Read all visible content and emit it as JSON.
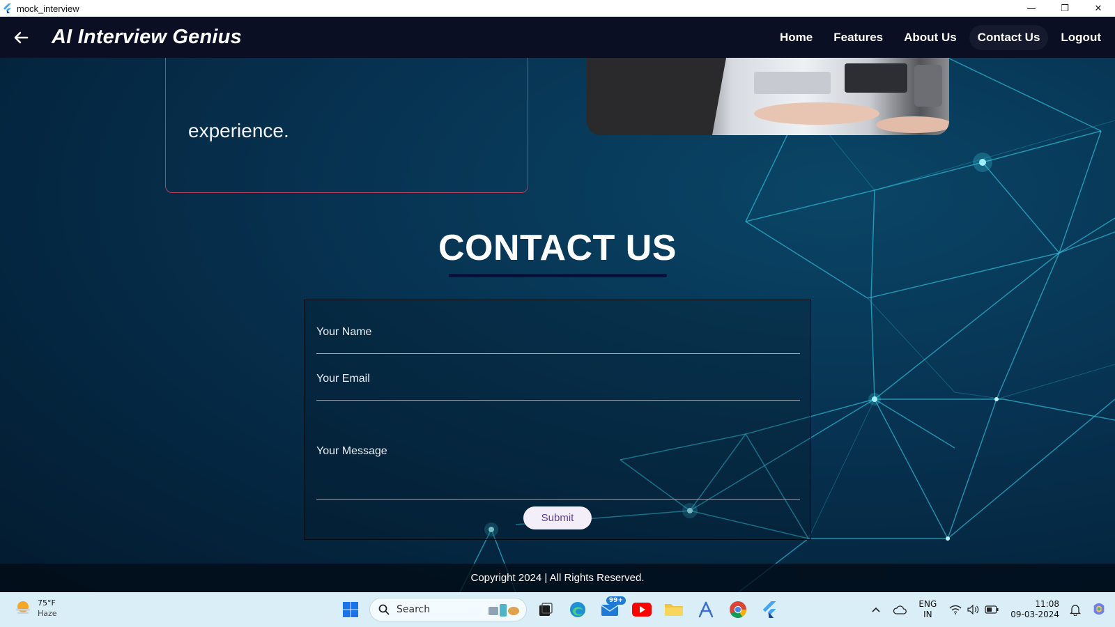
{
  "window": {
    "title": "mock_interview",
    "minimize_glyph": "—",
    "restore_glyph": "❐",
    "close_glyph": "✕"
  },
  "appbar": {
    "brand": "AI Interview Genius",
    "nav": [
      {
        "label": "Home"
      },
      {
        "label": "Features"
      },
      {
        "label": "About Us"
      },
      {
        "label": "Contact Us"
      },
      {
        "label": "Logout"
      }
    ],
    "active_nav": "Contact Us"
  },
  "experience_card": {
    "text": "experience."
  },
  "contact": {
    "title": "CONTACT US",
    "fields": {
      "name_label": "Your Name",
      "email_label": "Your Email",
      "message_label": "Your Message"
    },
    "submit_label": "Submit"
  },
  "footer": {
    "text": "Copyright 2024 | All Rights Reserved."
  },
  "taskbar": {
    "weather": {
      "temp": "75°F",
      "condition": "Haze"
    },
    "search_label": "Search",
    "mail_badge": "99+",
    "lang_primary": "ENG",
    "lang_secondary": "IN",
    "time": "11:08",
    "date": "09-03-2024"
  },
  "colors": {
    "appbar_bg": "#0b0f23",
    "card_border": "#b8405a",
    "submit_text": "#5a3d92",
    "taskbar_bg": "#d9eef6",
    "network_glow": "#3fd9f0"
  }
}
